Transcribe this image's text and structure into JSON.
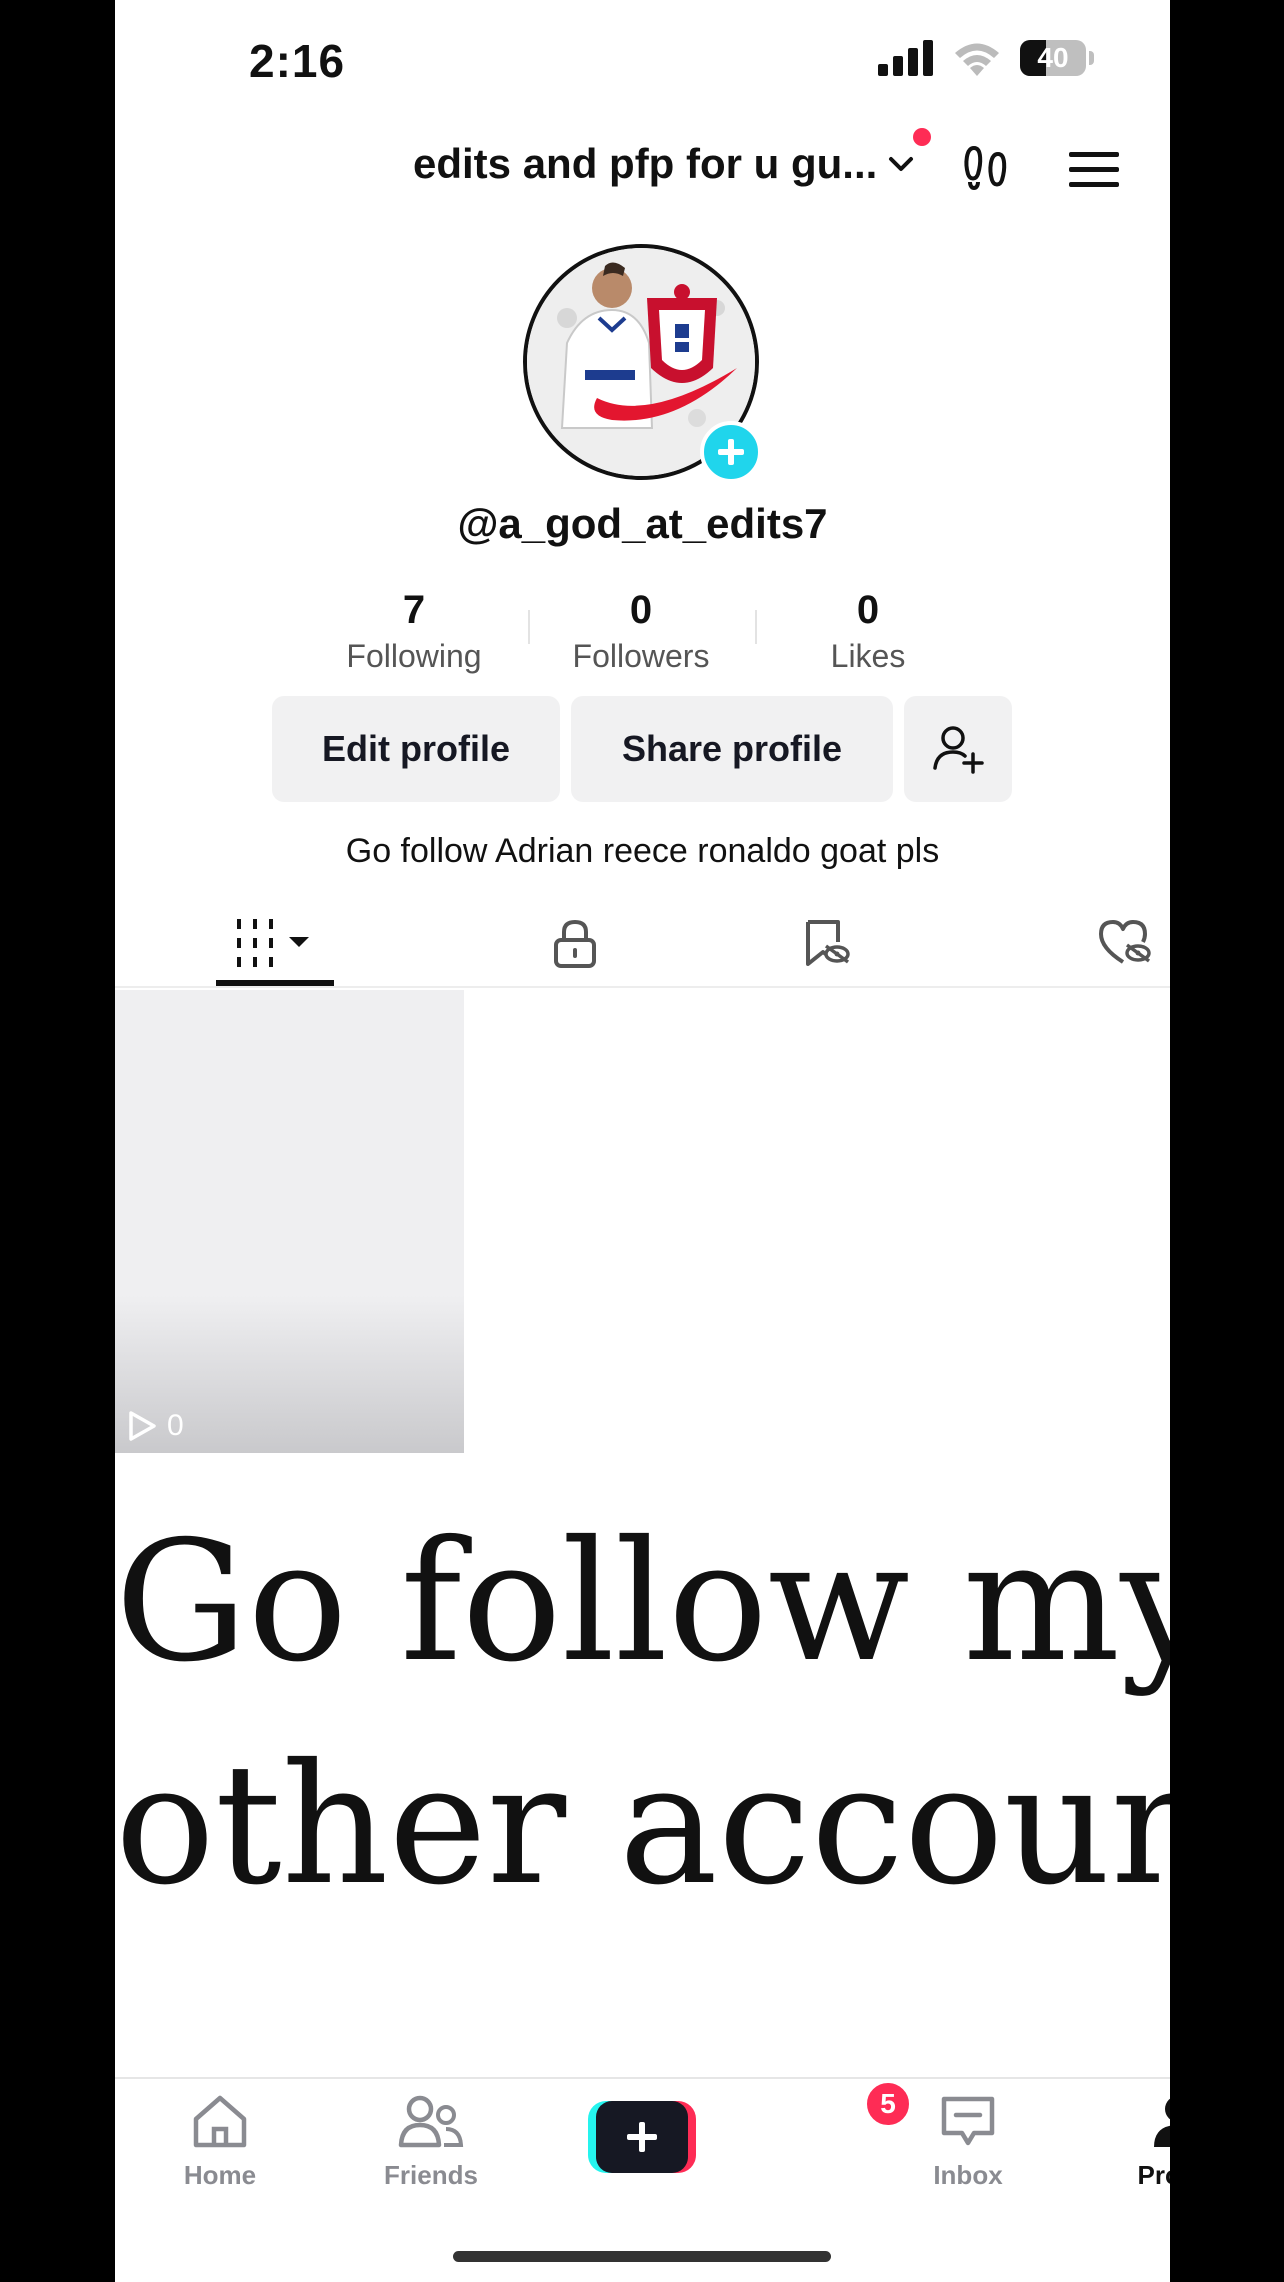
{
  "status_bar": {
    "time": "2:16",
    "battery_percent": "40",
    "battery_level": 0.4
  },
  "header": {
    "account_name": "edits and pfp for u gu...",
    "notification_dot_color": "#fe2c55"
  },
  "profile": {
    "username": "@a_god_at_edits7",
    "stats": [
      {
        "value": "7",
        "label": "Following"
      },
      {
        "value": "0",
        "label": "Followers"
      },
      {
        "value": "0",
        "label": "Likes"
      }
    ],
    "buttons": {
      "edit": "Edit profile",
      "share": "Share profile"
    },
    "bio": "Go follow Adrian reece ronaldo goat pls"
  },
  "content_tabs": [
    {
      "icon": "grid-videos-icon",
      "active": true
    },
    {
      "icon": "lock-icon"
    },
    {
      "icon": "bookmark-hidden-icon"
    },
    {
      "icon": "liked-hidden-icon"
    }
  ],
  "videos": [
    {
      "views": "0"
    }
  ],
  "overlay_text": {
    "line1": "Go follow my",
    "line2": "other account"
  },
  "bottom_nav": {
    "items": [
      {
        "label": "Home",
        "icon": "home-icon"
      },
      {
        "label": "Friends",
        "icon": "friends-icon"
      },
      {
        "label": "",
        "icon": "create-plus-icon"
      },
      {
        "label": "Inbox",
        "icon": "inbox-icon",
        "badge": "5"
      },
      {
        "label": "Profile",
        "icon": "profile-icon",
        "active": true
      }
    ]
  },
  "colors": {
    "accent_cyan": "#20d5ec",
    "accent_red": "#fe2c55",
    "text": "#161823"
  }
}
